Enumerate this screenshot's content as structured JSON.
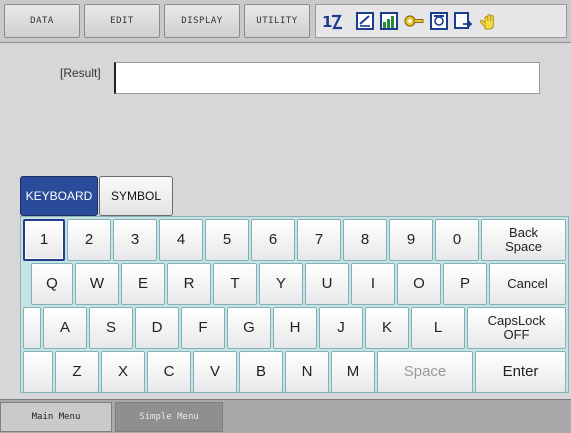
{
  "menu": {
    "data": "DATA",
    "edit": "EDIT",
    "display": "DISPLAY",
    "utility": "UTILITY"
  },
  "status_icons": [
    "axis-icon",
    "edit-lock-icon",
    "chart-icon",
    "key-icon",
    "screen-icon",
    "export-icon",
    "hand-icon"
  ],
  "result": {
    "label": "[Result]",
    "value": ""
  },
  "modes": {
    "keyboard": "KEYBOARD",
    "symbol": "SYMBOL",
    "active": "KEYBOARD"
  },
  "keyboard": {
    "row1": [
      "1",
      "2",
      "3",
      "4",
      "5",
      "6",
      "7",
      "8",
      "9",
      "0"
    ],
    "row1_back": "Back Space",
    "row2": [
      "Q",
      "W",
      "E",
      "R",
      "T",
      "Y",
      "U",
      "I",
      "O",
      "P"
    ],
    "row2_cancel": "Cancel",
    "row3": [
      "A",
      "S",
      "D",
      "F",
      "G",
      "H",
      "J",
      "K",
      "L"
    ],
    "row3_capslock": "CapsLock OFF",
    "row4": [
      "Z",
      "X",
      "C",
      "V",
      "B",
      "N",
      "M"
    ],
    "row4_space": "Space",
    "row4_enter": "Enter"
  },
  "bottom": {
    "main_menu": "Main Menu",
    "simple_menu": "Simple Menu"
  },
  "colors": {
    "active_tab": "#2a4a9a",
    "keyboard_bg": "#c7e2e4",
    "key_border": "#7fb3b6"
  }
}
